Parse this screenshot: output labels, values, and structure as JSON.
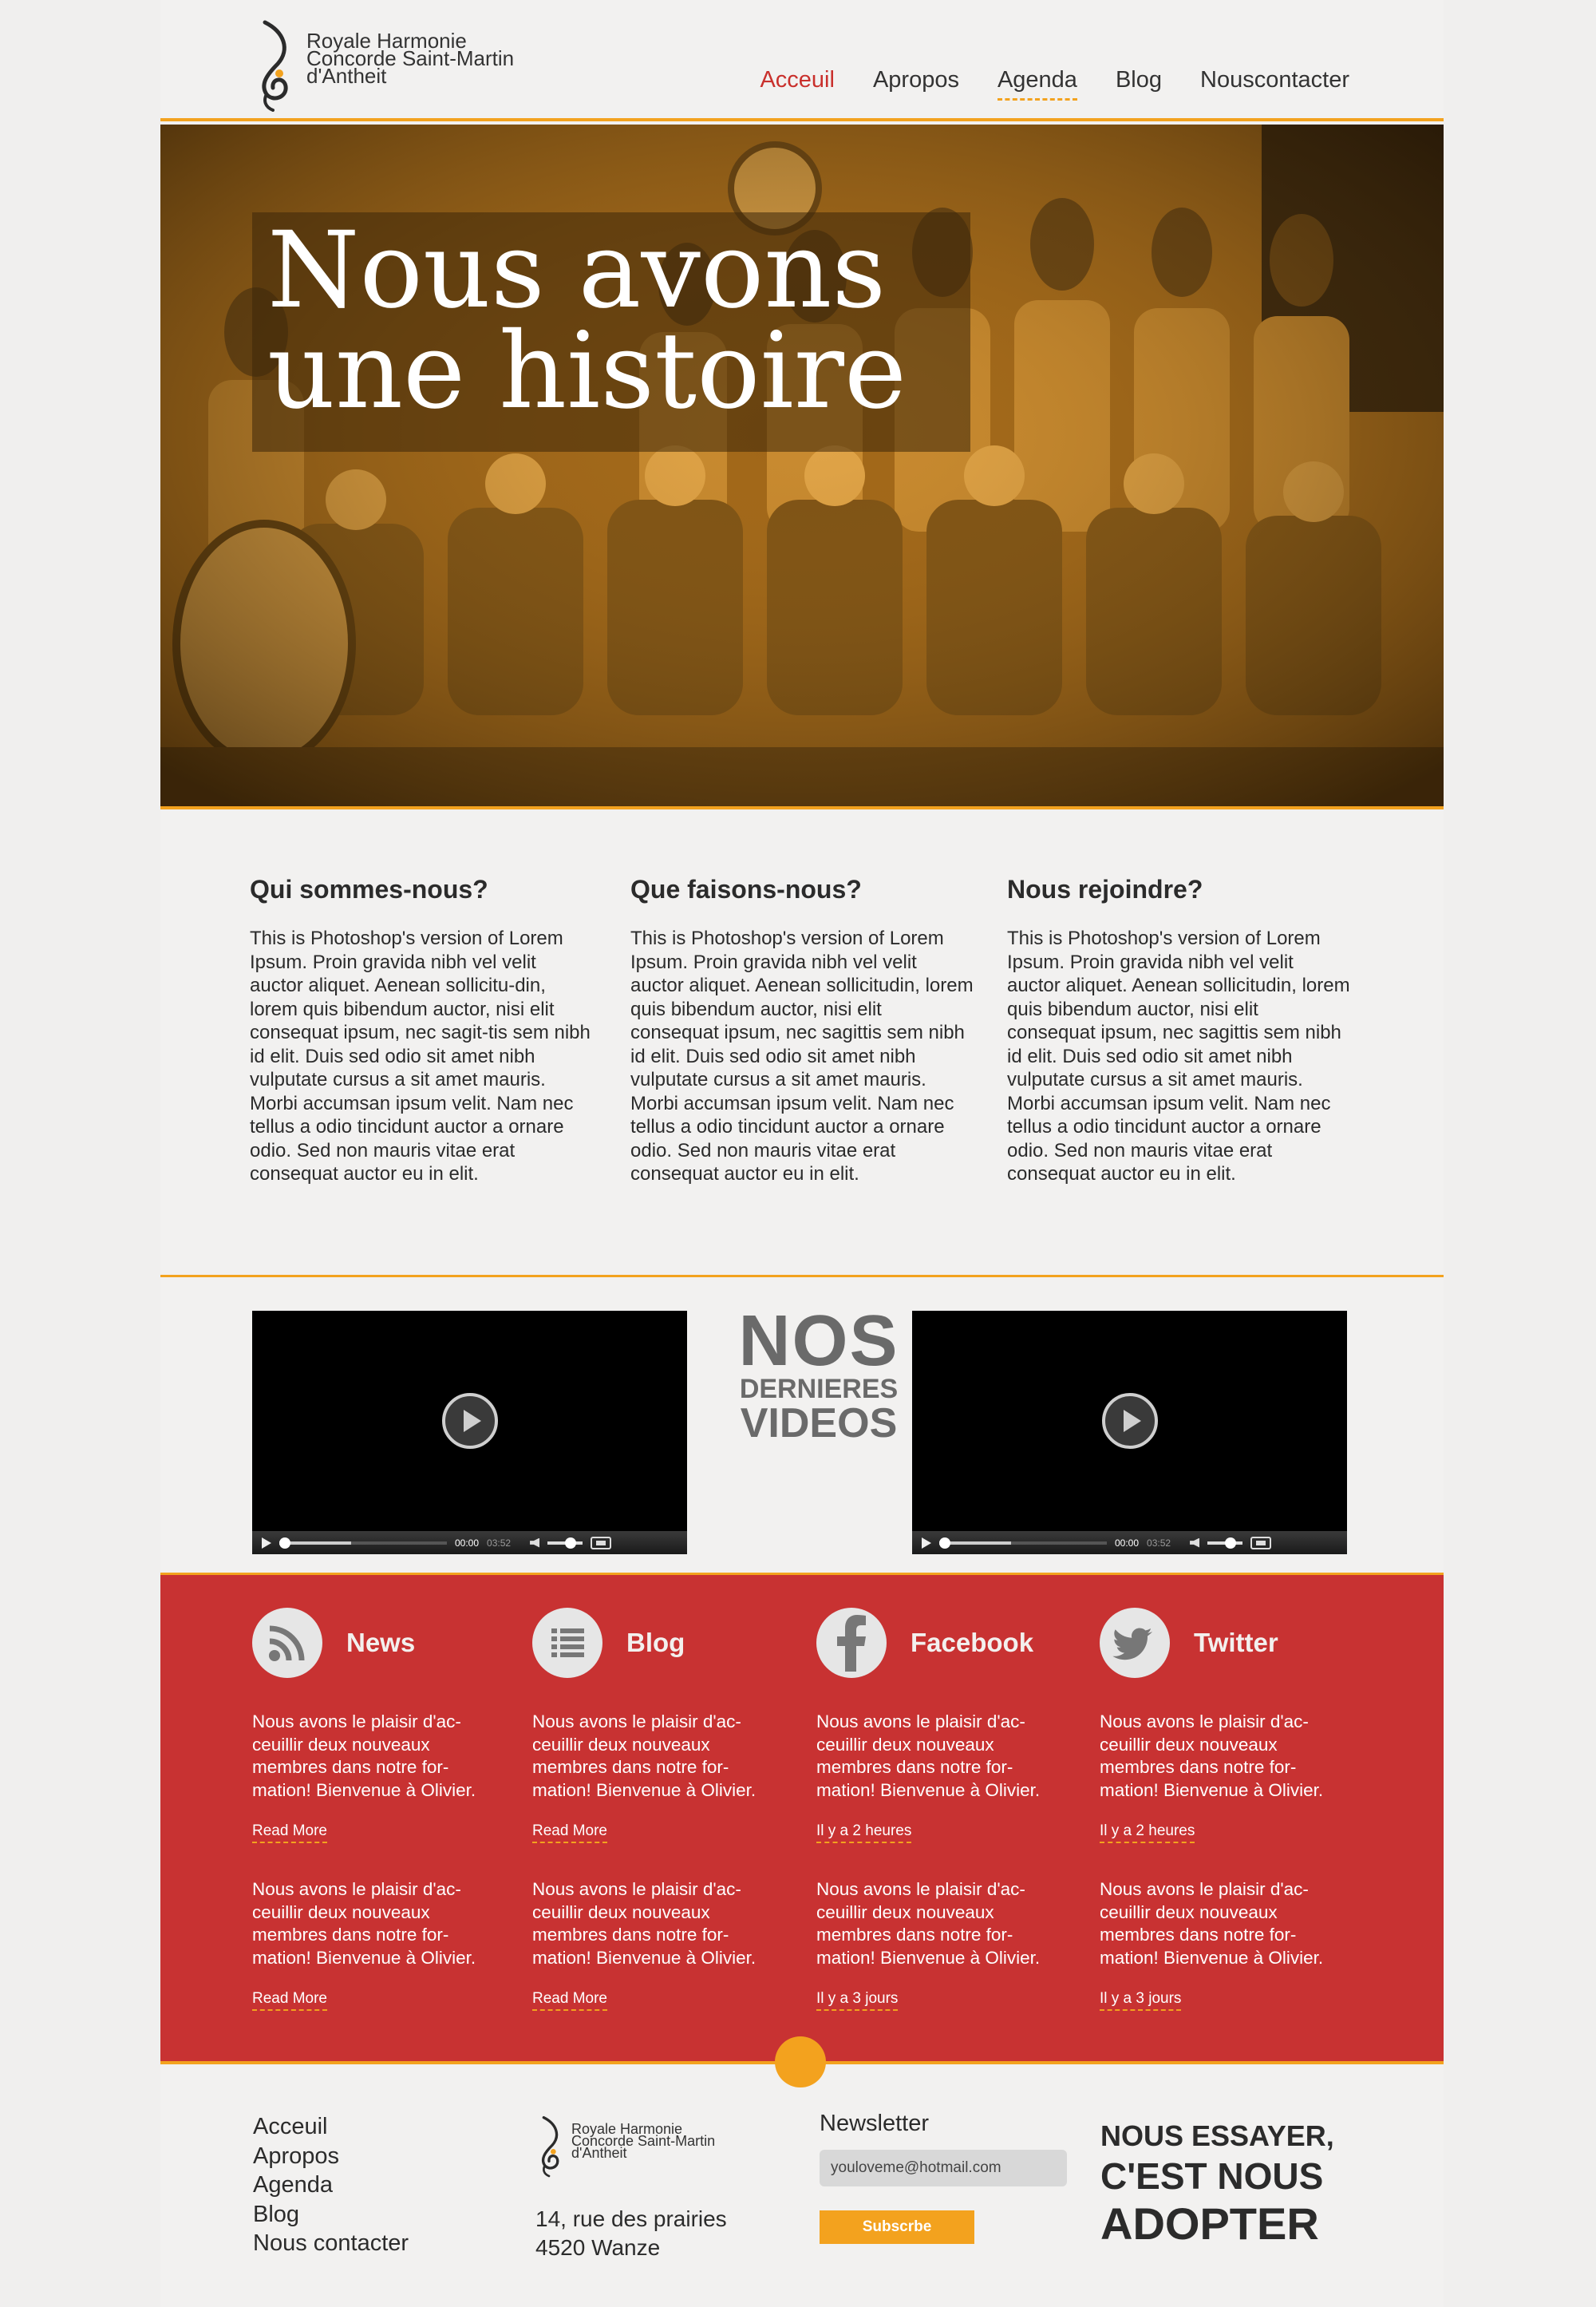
{
  "header": {
    "logo_lines": [
      "Royale Harmonie",
      "Concorde Saint-Martin",
      "d'Antheit"
    ],
    "nav": [
      {
        "label": "Acceuil",
        "state": "active"
      },
      {
        "label": "Apropos",
        "state": "normal"
      },
      {
        "label": "Agenda",
        "state": "underlined"
      },
      {
        "label": "Blog",
        "state": "normal"
      },
      {
        "label": "Nouscontacter",
        "state": "normal"
      }
    ]
  },
  "hero": {
    "title_line1": "Nous avons",
    "title_line2": "une histoire",
    "image": "historical-brass-band-photo"
  },
  "about": {
    "columns": [
      {
        "title": "Qui sommes-nous?",
        "text": "This is Photoshop's version  of Lorem Ipsum. Proin gravida nibh vel velit auctor aliquet. Aenean sollicitu-din, lorem quis bibendum auctor, nisi elit consequat ipsum, nec sagit-tis sem nibh id elit. Duis sed odio sit amet nibh vulputate cursus a sit amet mauris. Morbi accumsan ipsum velit. Nam nec tellus a odio tincidunt auctor a ornare odio. Sed non  mauris vitae erat consequat auctor eu in elit."
      },
      {
        "title": "Que faisons-nous?",
        "text": "This is Photoshop's version  of Lorem Ipsum. Proin gravida nibh vel velit auctor aliquet. Aenean sollicitudin, lorem quis bibendum auctor, nisi elit consequat ipsum, nec sagittis sem nibh id elit. Duis sed odio sit amet nibh vulputate cursus a sit amet mauris. Morbi accumsan ipsum velit. Nam nec tellus a odio tincidunt auctor a ornare odio. Sed non mauris vitae erat consequat auctor eu in elit."
      },
      {
        "title": "Nous rejoindre?",
        "text": "This is Photoshop's version  of Lorem Ipsum. Proin gravida nibh vel velit auctor aliquet. Aenean sollicitudin, lorem quis bibendum auctor, nisi elit consequat ipsum, nec sagittis sem nibh id elit. Duis sed odio sit amet nibh vulputate cursus a sit amet mauris. Morbi accumsan ipsum velit. Nam nec tellus a odio tincidunt auctor a ornare odio. Sed non mauris vitae erat consequat auctor eu in elit."
      }
    ]
  },
  "videos": {
    "heading_line1": "NOS",
    "heading_line2": "DERNIERES",
    "heading_line3": "VIDEOS",
    "players": [
      {
        "time": "00:00",
        "duration": "03:52"
      },
      {
        "time": "00:00",
        "duration": "03:52"
      }
    ]
  },
  "social": {
    "columns": [
      {
        "title": "News",
        "icon": "rss-icon",
        "items": [
          {
            "text": "Nous avons le plaisir d'ac-ceuillir deux nouveaux membres dans notre for-mation! Bienvenue à Olivier.",
            "link": "Read More"
          },
          {
            "text": "Nous avons le plaisir d'ac-ceuillir deux nouveaux membres dans notre for-mation! Bienvenue à Olivier.",
            "link": "Read More"
          }
        ]
      },
      {
        "title": "Blog",
        "icon": "list-icon",
        "items": [
          {
            "text": "Nous avons le plaisir d'ac-ceuillir deux nouveaux membres dans notre for-mation! Bienvenue à Olivier.",
            "link": "Read More"
          },
          {
            "text": "Nous avons le plaisir d'ac-ceuillir deux nouveaux membres dans notre for-mation! Bienvenue à Olivier.",
            "link": "Read More"
          }
        ]
      },
      {
        "title": "Facebook",
        "icon": "facebook-icon",
        "items": [
          {
            "text": "Nous avons le plaisir d'ac-ceuillir deux nouveaux membres dans notre for-mation! Bienvenue à Olivier.",
            "link": "Il y a 2 heures"
          },
          {
            "text": "Nous avons le plaisir d'ac-ceuillir deux nouveaux membres dans notre for-mation! Bienvenue à Olivier.",
            "link": "Il y a 3 jours"
          }
        ]
      },
      {
        "title": "Twitter",
        "icon": "twitter-icon",
        "items": [
          {
            "text": "Nous avons le plaisir d'ac-ceuillir deux nouveaux membres dans notre for-mation! Bienvenue à Olivier.",
            "link": "Il y a 2 heures"
          },
          {
            "text": "Nous avons le plaisir d'ac-ceuillir deux nouveaux membres dans notre for-mation! Bienvenue à Olivier.",
            "link": "Il y a 3 jours"
          }
        ]
      }
    ]
  },
  "footer": {
    "links": [
      "Acceuil",
      "Apropos",
      "Agenda",
      "Blog",
      "Nous contacter"
    ],
    "logo_lines": [
      "Royale Harmonie",
      "Concorde Saint-Martin",
      "d'Antheit"
    ],
    "address_line1": "14, rue des prairies",
    "address_line2": "4520 Wanze",
    "newsletter_title": "Newsletter",
    "newsletter_value": "youloveme@hotmail.com",
    "subscribe_label": "Subscrbe",
    "cta_line1": "NOUS ESSAYER,",
    "cta_line2": "C'EST NOUS",
    "cta_line3": "ADOPTER"
  },
  "colors": {
    "accent": "#f3a21e",
    "red": "#c83232",
    "nav_active": "#c9302c",
    "text": "#2b2b2b",
    "background": "#f2f1f0"
  }
}
